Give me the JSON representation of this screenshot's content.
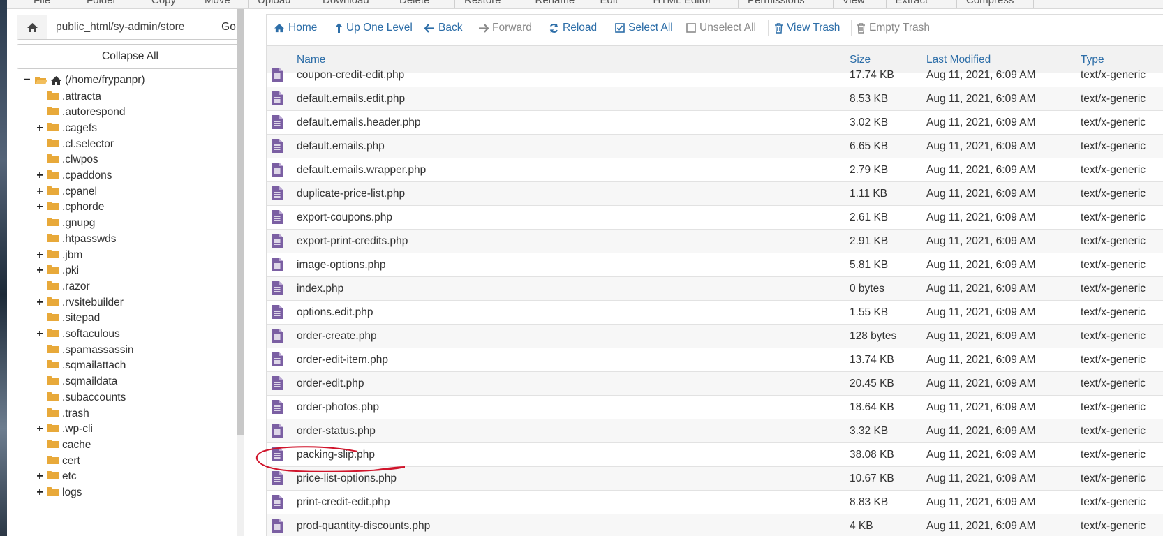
{
  "top_toolbar": {
    "items": [
      "File",
      "Folder",
      "Copy",
      "Move",
      "Upload",
      "Download",
      "Delete",
      "Restore",
      "Rename",
      "Edit",
      "HTML Editor",
      "Permissions",
      "View",
      "Extract",
      "Compress"
    ]
  },
  "sidebar": {
    "path_value": "public_html/sy-admin/store",
    "go_label": "Go",
    "collapse_label": "Collapse All",
    "root_label": "(/home/frypanpr)",
    "items": [
      {
        "label": ".attracta",
        "expandable": false
      },
      {
        "label": ".autorespond",
        "expandable": false
      },
      {
        "label": ".cagefs",
        "expandable": true
      },
      {
        "label": ".cl.selector",
        "expandable": false
      },
      {
        "label": ".clwpos",
        "expandable": false
      },
      {
        "label": ".cpaddons",
        "expandable": true
      },
      {
        "label": ".cpanel",
        "expandable": true
      },
      {
        "label": ".cphorde",
        "expandable": true
      },
      {
        "label": ".gnupg",
        "expandable": false
      },
      {
        "label": ".htpasswds",
        "expandable": false
      },
      {
        "label": ".jbm",
        "expandable": true
      },
      {
        "label": ".pki",
        "expandable": true
      },
      {
        "label": ".razor",
        "expandable": false
      },
      {
        "label": ".rvsitebuilder",
        "expandable": true
      },
      {
        "label": ".sitepad",
        "expandable": false
      },
      {
        "label": ".softaculous",
        "expandable": true
      },
      {
        "label": ".spamassassin",
        "expandable": false
      },
      {
        "label": ".sqmailattach",
        "expandable": false
      },
      {
        "label": ".sqmaildata",
        "expandable": false
      },
      {
        "label": ".subaccounts",
        "expandable": false
      },
      {
        "label": ".trash",
        "expandable": false
      },
      {
        "label": ".wp-cli",
        "expandable": true
      },
      {
        "label": "cache",
        "expandable": false
      },
      {
        "label": "cert",
        "expandable": false
      },
      {
        "label": "etc",
        "expandable": true
      },
      {
        "label": "logs",
        "expandable": true
      }
    ]
  },
  "actions": {
    "home": "Home",
    "up_one_level": "Up One Level",
    "back": "Back",
    "forward": "Forward",
    "reload": "Reload",
    "select_all": "Select All",
    "unselect_all": "Unselect All",
    "view_trash": "View Trash",
    "empty_trash": "Empty Trash"
  },
  "table": {
    "columns": [
      "Name",
      "Size",
      "Last Modified",
      "Type"
    ],
    "rows": [
      {
        "name": "coupon-credit-edit.php",
        "size": "17.74 KB",
        "modified": "Aug 11, 2021, 6:09 AM",
        "type": "text/x-generic"
      },
      {
        "name": "default.emails.edit.php",
        "size": "8.53 KB",
        "modified": "Aug 11, 2021, 6:09 AM",
        "type": "text/x-generic"
      },
      {
        "name": "default.emails.header.php",
        "size": "3.02 KB",
        "modified": "Aug 11, 2021, 6:09 AM",
        "type": "text/x-generic"
      },
      {
        "name": "default.emails.php",
        "size": "6.65 KB",
        "modified": "Aug 11, 2021, 6:09 AM",
        "type": "text/x-generic"
      },
      {
        "name": "default.emails.wrapper.php",
        "size": "2.79 KB",
        "modified": "Aug 11, 2021, 6:09 AM",
        "type": "text/x-generic"
      },
      {
        "name": "duplicate-price-list.php",
        "size": "1.11 KB",
        "modified": "Aug 11, 2021, 6:09 AM",
        "type": "text/x-generic"
      },
      {
        "name": "export-coupons.php",
        "size": "2.61 KB",
        "modified": "Aug 11, 2021, 6:09 AM",
        "type": "text/x-generic"
      },
      {
        "name": "export-print-credits.php",
        "size": "2.91 KB",
        "modified": "Aug 11, 2021, 6:09 AM",
        "type": "text/x-generic"
      },
      {
        "name": "image-options.php",
        "size": "5.81 KB",
        "modified": "Aug 11, 2021, 6:09 AM",
        "type": "text/x-generic"
      },
      {
        "name": "index.php",
        "size": "0 bytes",
        "modified": "Aug 11, 2021, 6:09 AM",
        "type": "text/x-generic"
      },
      {
        "name": "options.edit.php",
        "size": "1.55 KB",
        "modified": "Aug 11, 2021, 6:09 AM",
        "type": "text/x-generic"
      },
      {
        "name": "order-create.php",
        "size": "128 bytes",
        "modified": "Aug 11, 2021, 6:09 AM",
        "type": "text/x-generic"
      },
      {
        "name": "order-edit-item.php",
        "size": "13.74 KB",
        "modified": "Aug 11, 2021, 6:09 AM",
        "type": "text/x-generic"
      },
      {
        "name": "order-edit.php",
        "size": "20.45 KB",
        "modified": "Aug 11, 2021, 6:09 AM",
        "type": "text/x-generic"
      },
      {
        "name": "order-photos.php",
        "size": "18.64 KB",
        "modified": "Aug 11, 2021, 6:09 AM",
        "type": "text/x-generic"
      },
      {
        "name": "order-status.php",
        "size": "3.32 KB",
        "modified": "Aug 11, 2021, 6:09 AM",
        "type": "text/x-generic"
      },
      {
        "name": "packing-slip.php",
        "size": "38.08 KB",
        "modified": "Aug 11, 2021, 6:09 AM",
        "type": "text/x-generic"
      },
      {
        "name": "price-list-options.php",
        "size": "10.67 KB",
        "modified": "Aug 11, 2021, 6:09 AM",
        "type": "text/x-generic"
      },
      {
        "name": "print-credit-edit.php",
        "size": "8.83 KB",
        "modified": "Aug 11, 2021, 6:09 AM",
        "type": "text/x-generic"
      },
      {
        "name": "prod-quantity-discounts.php",
        "size": "4 KB",
        "modified": "Aug 11, 2021, 6:09 AM",
        "type": "text/x-generic"
      }
    ]
  },
  "colors": {
    "accent": "#2d6ea8",
    "folder": "#e8a93a",
    "file_icon": "#7b5fa3",
    "annotation": "#d0142b"
  },
  "icons": {
    "home": "home-icon",
    "folder": "folder-icon",
    "file": "file-icon"
  }
}
